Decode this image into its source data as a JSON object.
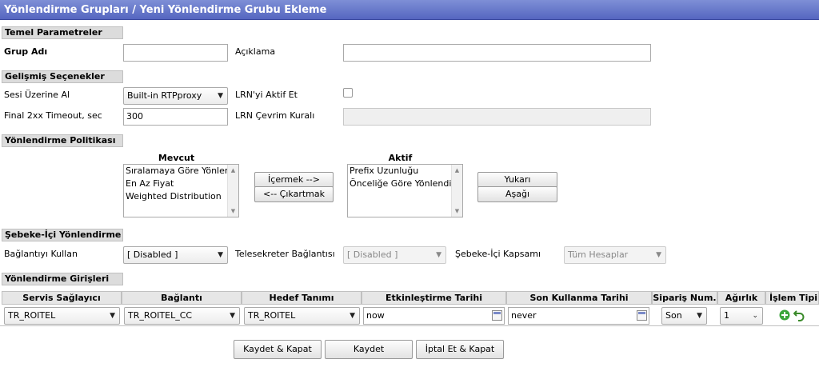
{
  "title": "Yönlendirme Grupları / Yeni Yönlendirme Grubu Ekleme",
  "sections": {
    "temel": "Temel Parametreler",
    "gelismis": "Gelişmiş Seçenekler",
    "politika": "Yönlendirme Politikası",
    "sebeke": "Şebeke-İçi Yönlendirme",
    "girisler": "Yönlendirme Girişleri"
  },
  "temel": {
    "grup_adi_label": "Grup Adı",
    "grup_adi_value": "",
    "aciklama_label": "Açıklama",
    "aciklama_value": ""
  },
  "gelismis": {
    "sesi_label": "Sesi Üzerine Al",
    "sesi_value": "Built-in RTPproxy",
    "lrn_aktif_label": "LRN'yi Aktif Et",
    "lrn_aktif_checked": false,
    "timeout_label": "Final 2xx Timeout, sec",
    "timeout_value": "300",
    "lrn_kural_label": "LRN Çevrim Kuralı",
    "lrn_kural_value": ""
  },
  "politika": {
    "mevcut_label": "Mevcut",
    "aktif_label": "Aktif",
    "mevcut_items": [
      "Sıralamaya Göre Yönlendirme",
      "En Az Fiyat",
      "Weighted Distribution"
    ],
    "aktif_items": [
      "Prefix Uzunluğu",
      "Önceliğe Göre Yönlendirme"
    ],
    "icermek": "İçermek -->",
    "cikartmak": "<-- Çıkartmak",
    "yukari": "Yukarı",
    "asagi": "Aşağı"
  },
  "sebeke": {
    "baglanti_label": "Bağlantıyı Kullan",
    "baglanti_value": "[ Disabled ]",
    "telesekreter_label": "Telesekreter Bağlantısı",
    "telesekreter_value": "[ Disabled ]",
    "kapsam_label": "Şebeke-İçi Kapsamı",
    "kapsam_value": "Tüm Hesaplar"
  },
  "girisler": {
    "headers": [
      "Servis Sağlayıcı",
      "Bağlantı",
      "Hedef Tanımı",
      "Etkinleştirme Tarihi",
      "Son Kullanma Tarihi",
      "Sipariş Num.",
      "Ağırlık",
      "İşlem Tipi"
    ],
    "row": {
      "servis": "TR_ROITEL",
      "baglanti": "TR_ROITEL_CC",
      "hedef": "TR_ROITEL",
      "etkin": "now",
      "son": "never",
      "siparis": "Son",
      "agirlik": "1"
    }
  },
  "buttons": {
    "kaydet_kapat": "Kaydet & Kapat",
    "kaydet": "Kaydet",
    "iptal": "İptal Et & Kapat"
  },
  "colors": {
    "titlebar": "#5f70c8",
    "section_bg": "#dcdcdc",
    "add_icon": "#3aa53a",
    "undo_icon": "#3a8a2a"
  }
}
